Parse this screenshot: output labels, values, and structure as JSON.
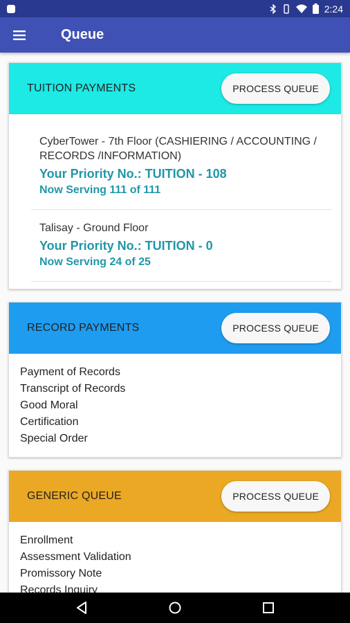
{
  "status_bar": {
    "time": "2:24",
    "icons": [
      "notification-icon",
      "bluetooth-icon",
      "wifi-icon",
      "battery-icon"
    ]
  },
  "app_bar": {
    "title": "Queue",
    "menu_icon": "hamburger-menu-icon"
  },
  "tuition_card": {
    "header": "TUITION PAYMENTS",
    "button": "PROCESS QUEUE",
    "color": "#1de9e5",
    "locations": [
      {
        "name": "CyberTower - 7th Floor (CASHIERING / ACCOUNTING / RECORDS /INFORMATION)",
        "priority": "Your Priority No.: TUITION - 108",
        "serving": "Now Serving 111 of 111"
      },
      {
        "name": "Talisay - Ground Floor",
        "priority": "Your Priority No.: TUITION - 0",
        "serving": "Now Serving 24 of 25"
      }
    ]
  },
  "records_card": {
    "header": "RECORD PAYMENTS",
    "button": "PROCESS QUEUE",
    "color": "#1e9cf0",
    "items": [
      "Payment of Records",
      "Transcript of Records",
      "Good Moral",
      "Certification",
      "Special Order"
    ]
  },
  "generic_card": {
    "header": "GENERIC QUEUE",
    "button": "PROCESS QUEUE",
    "color": "#eba824",
    "items": [
      "Enrollment",
      "Assessment Validation",
      "Promissory Note",
      "Records Inquiry"
    ]
  },
  "nav_bar": {
    "icons": [
      "back-icon",
      "home-icon",
      "recents-icon"
    ]
  }
}
